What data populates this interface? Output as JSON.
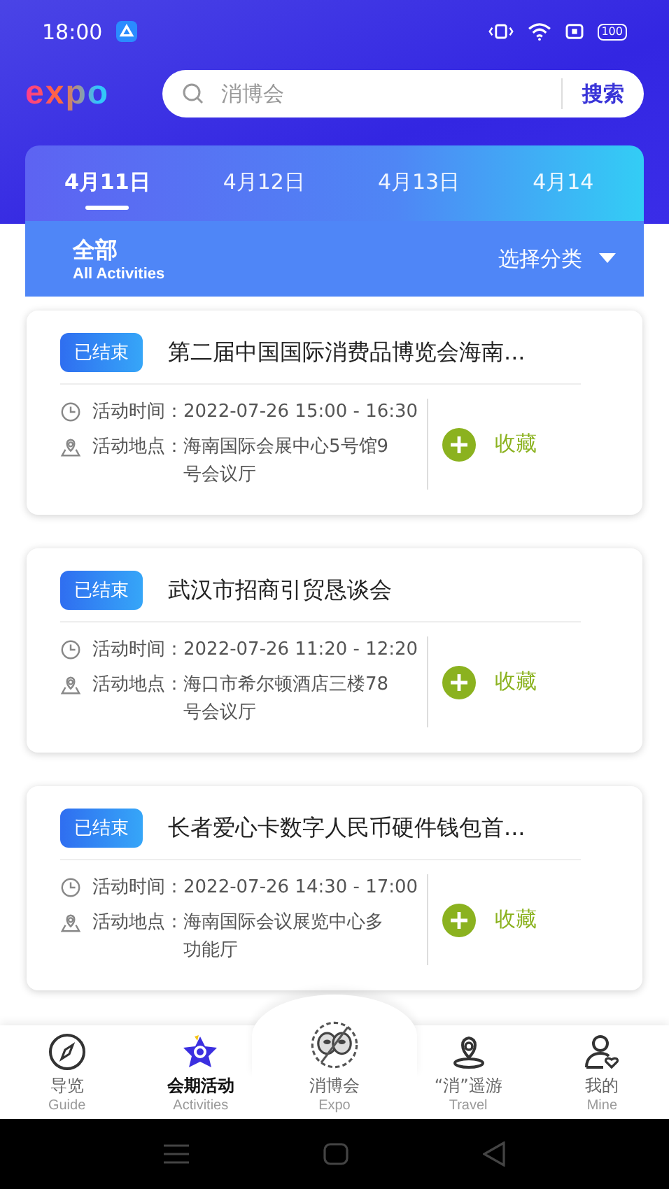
{
  "status_bar": {
    "time": "18:00",
    "battery": "100"
  },
  "header": {
    "logo": "expo",
    "search": {
      "placeholder": "消博会",
      "button": "搜索"
    }
  },
  "date_tabs": [
    {
      "label": "4月11日",
      "selected": true
    },
    {
      "label": "4月12日",
      "selected": false
    },
    {
      "label": "4月13日",
      "selected": false
    },
    {
      "label": "4月14",
      "selected": false
    }
  ],
  "category_bar": {
    "title": "全部",
    "subtitle": "All Activities",
    "filter": "选择分类"
  },
  "events": [
    {
      "status": "已结束",
      "title": "第二届中国国际消费品博览会海南...",
      "time_label": "活动时间：",
      "time": "2022-07-26 15:00 - 16:30",
      "place_label": "活动地点：",
      "place": "海南国际会展中心5号馆9号会议厅",
      "favorite": "收藏"
    },
    {
      "status": "已结束",
      "title": "武汉市招商引贸恳谈会",
      "time_label": "活动时间：",
      "time": "2022-07-26 11:20 - 12:20",
      "place_label": "活动地点：",
      "place": "海口市希尔顿酒店三楼78号会议厅",
      "favorite": "收藏"
    },
    {
      "status": "已结束",
      "title": "长者爱心卡数字人民币硬件钱包首...",
      "time_label": "活动时间：",
      "time": "2022-07-26 14:30 - 17:00",
      "place_label": "活动地点：",
      "place": "海南国际会议展览中心多功能厅",
      "favorite": "收藏"
    }
  ],
  "bottom_nav": [
    {
      "kind": "guide",
      "label": "导览",
      "sublabel": "Guide",
      "selected": false
    },
    {
      "kind": "activities",
      "label": "会期活动",
      "sublabel": "Activities",
      "selected": true
    },
    {
      "kind": "expo",
      "label": "消博会",
      "sublabel": "Expo",
      "selected": false
    },
    {
      "kind": "travel",
      "label": "“消”遥游",
      "sublabel": "Travel",
      "selected": false
    },
    {
      "kind": "mine",
      "label": "我的",
      "sublabel": "Mine",
      "selected": false
    }
  ]
}
